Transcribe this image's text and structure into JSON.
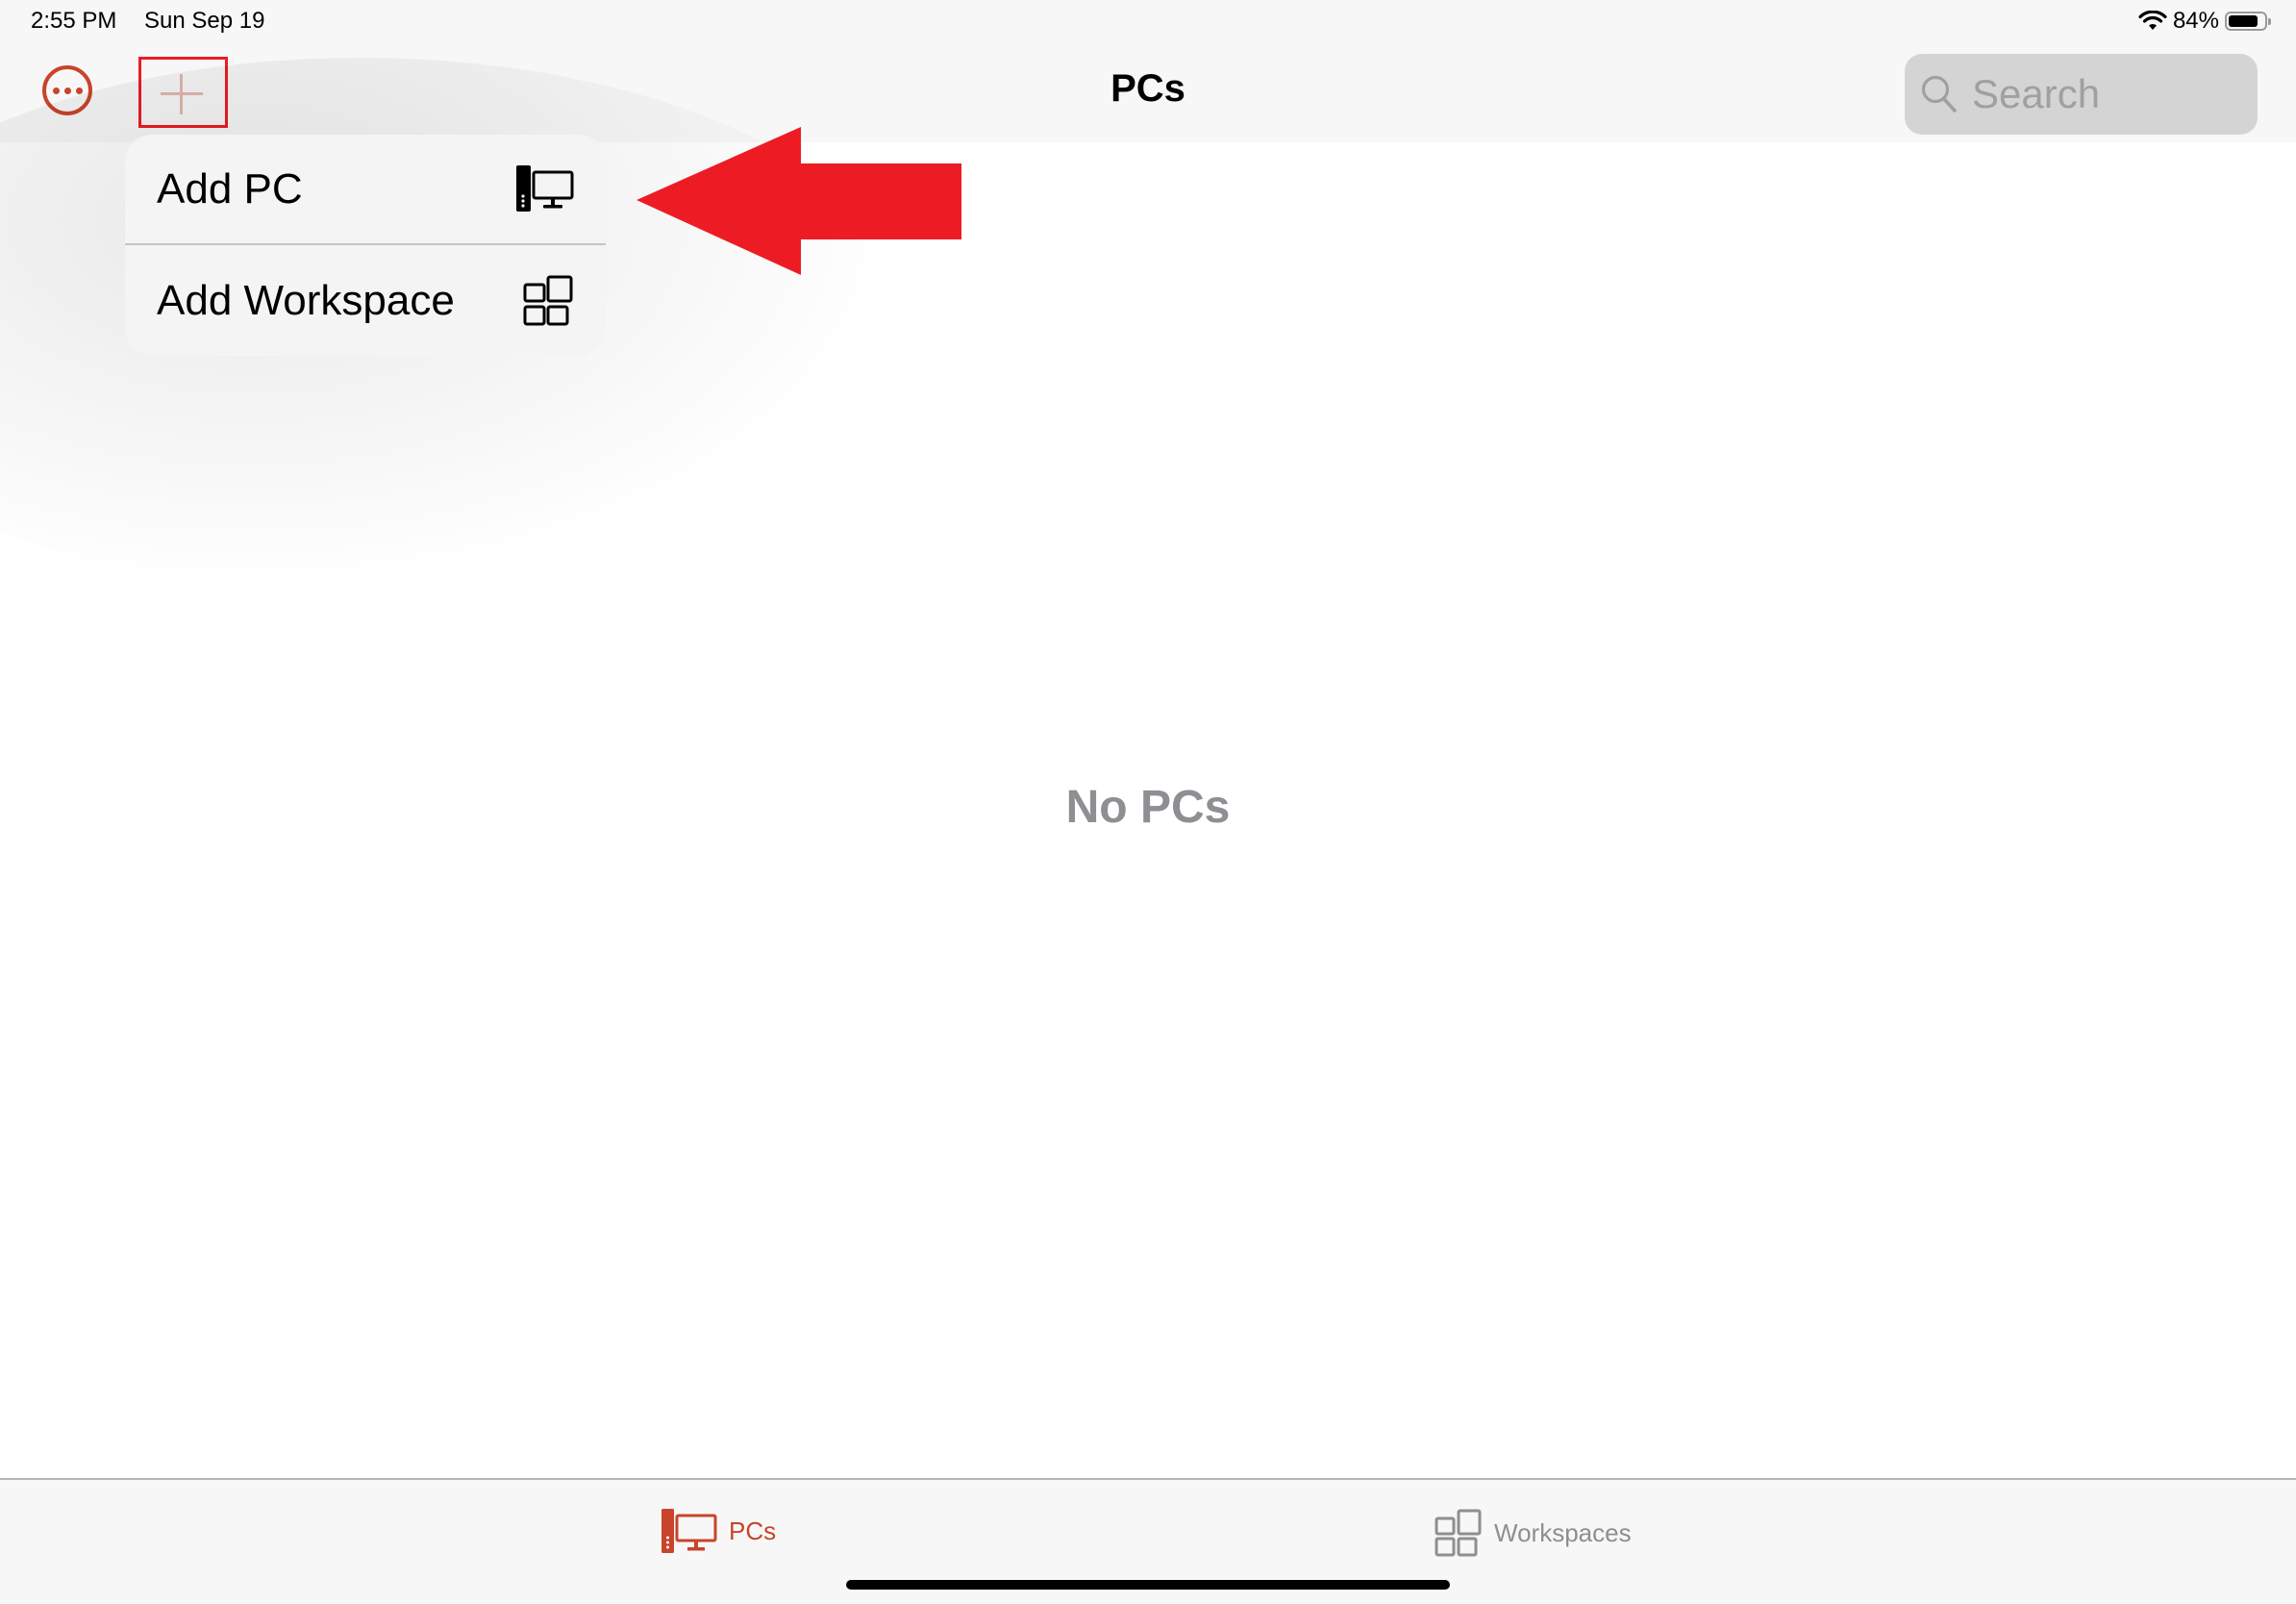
{
  "status_bar": {
    "time": "2:55 PM",
    "date": "Sun Sep 19",
    "battery_percent_label": "84%",
    "battery_level": 0.84,
    "icons": [
      "wifi-icon",
      "battery-icon"
    ]
  },
  "nav_bar": {
    "title": "PCs",
    "more_button_icon": "ellipsis-circle-icon",
    "add_button_icon": "plus-icon",
    "search": {
      "placeholder": "Search",
      "value": "",
      "icon": "search-icon"
    }
  },
  "add_menu": {
    "items": [
      {
        "label": "Add PC",
        "icon": "desktop-pc-icon"
      },
      {
        "label": "Add Workspace",
        "icon": "workspace-grid-icon"
      }
    ]
  },
  "annotation": {
    "type": "arrow",
    "color": "#ed1c24",
    "points_to": "Add PC"
  },
  "main": {
    "empty_message": "No PCs"
  },
  "tab_bar": {
    "tabs": [
      {
        "label": "PCs",
        "icon": "desktop-pc-icon",
        "selected": true
      },
      {
        "label": "Workspaces",
        "icon": "workspace-grid-icon",
        "selected": false
      }
    ]
  },
  "colors": {
    "accent": "#c8442a",
    "highlight_box": "#ed1c24",
    "inactive": "#8e8e93"
  }
}
